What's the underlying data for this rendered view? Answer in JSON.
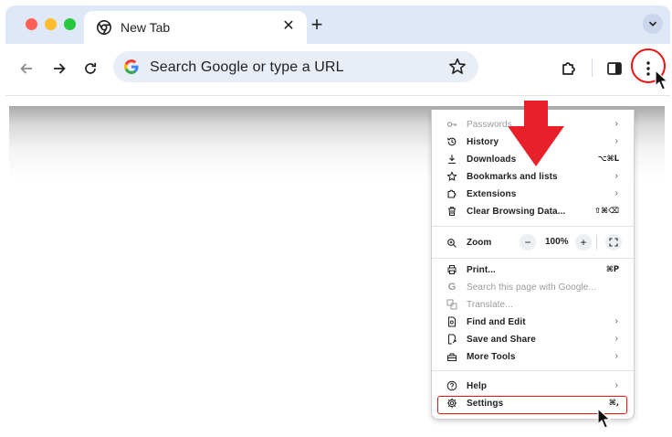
{
  "tab": {
    "title": "New Tab",
    "close": "✕",
    "new": "+"
  },
  "omnibox": {
    "placeholder": "Search Google or type a URL"
  },
  "menu": {
    "items": [
      {
        "label": "Passwords",
        "shortcut": "",
        "chev": "›"
      },
      {
        "label": "History",
        "shortcut": "",
        "chev": "›"
      },
      {
        "label": "Downloads",
        "shortcut": "⌥⌘L",
        "chev": ""
      },
      {
        "label": "Bookmarks and lists",
        "shortcut": "",
        "chev": "›"
      },
      {
        "label": "Extensions",
        "shortcut": "",
        "chev": "›"
      },
      {
        "label": "Clear Browsing Data...",
        "shortcut": "⇧⌘⌫",
        "chev": ""
      },
      {
        "label": "Print...",
        "shortcut": "⌘P",
        "chev": ""
      },
      {
        "label": "Search this page with Google...",
        "shortcut": "",
        "chev": ""
      },
      {
        "label": "Translate...",
        "shortcut": "",
        "chev": ""
      },
      {
        "label": "Find and Edit",
        "shortcut": "",
        "chev": "›"
      },
      {
        "label": "Save and Share",
        "shortcut": "",
        "chev": "›"
      },
      {
        "label": "More Tools",
        "shortcut": "",
        "chev": "›"
      },
      {
        "label": "Help",
        "shortcut": "",
        "chev": "›"
      },
      {
        "label": "Settings",
        "shortcut": "⌘,",
        "chev": ""
      }
    ],
    "zoom": {
      "label": "Zoom",
      "minus": "−",
      "value": "100%",
      "plus": "+"
    }
  },
  "colors": {
    "highlight": "#e11111",
    "arrow": "#e8202a",
    "tabstrip": "#dfe8f6",
    "omnibox": "#e9eef6"
  },
  "icons": [
    "chrome-icon",
    "back-icon",
    "forward-icon",
    "reload-icon",
    "google-icon",
    "star-icon",
    "extensions-icon",
    "side-panel-icon",
    "menu-dots-icon",
    "cursor-icon",
    "red-arrow"
  ]
}
